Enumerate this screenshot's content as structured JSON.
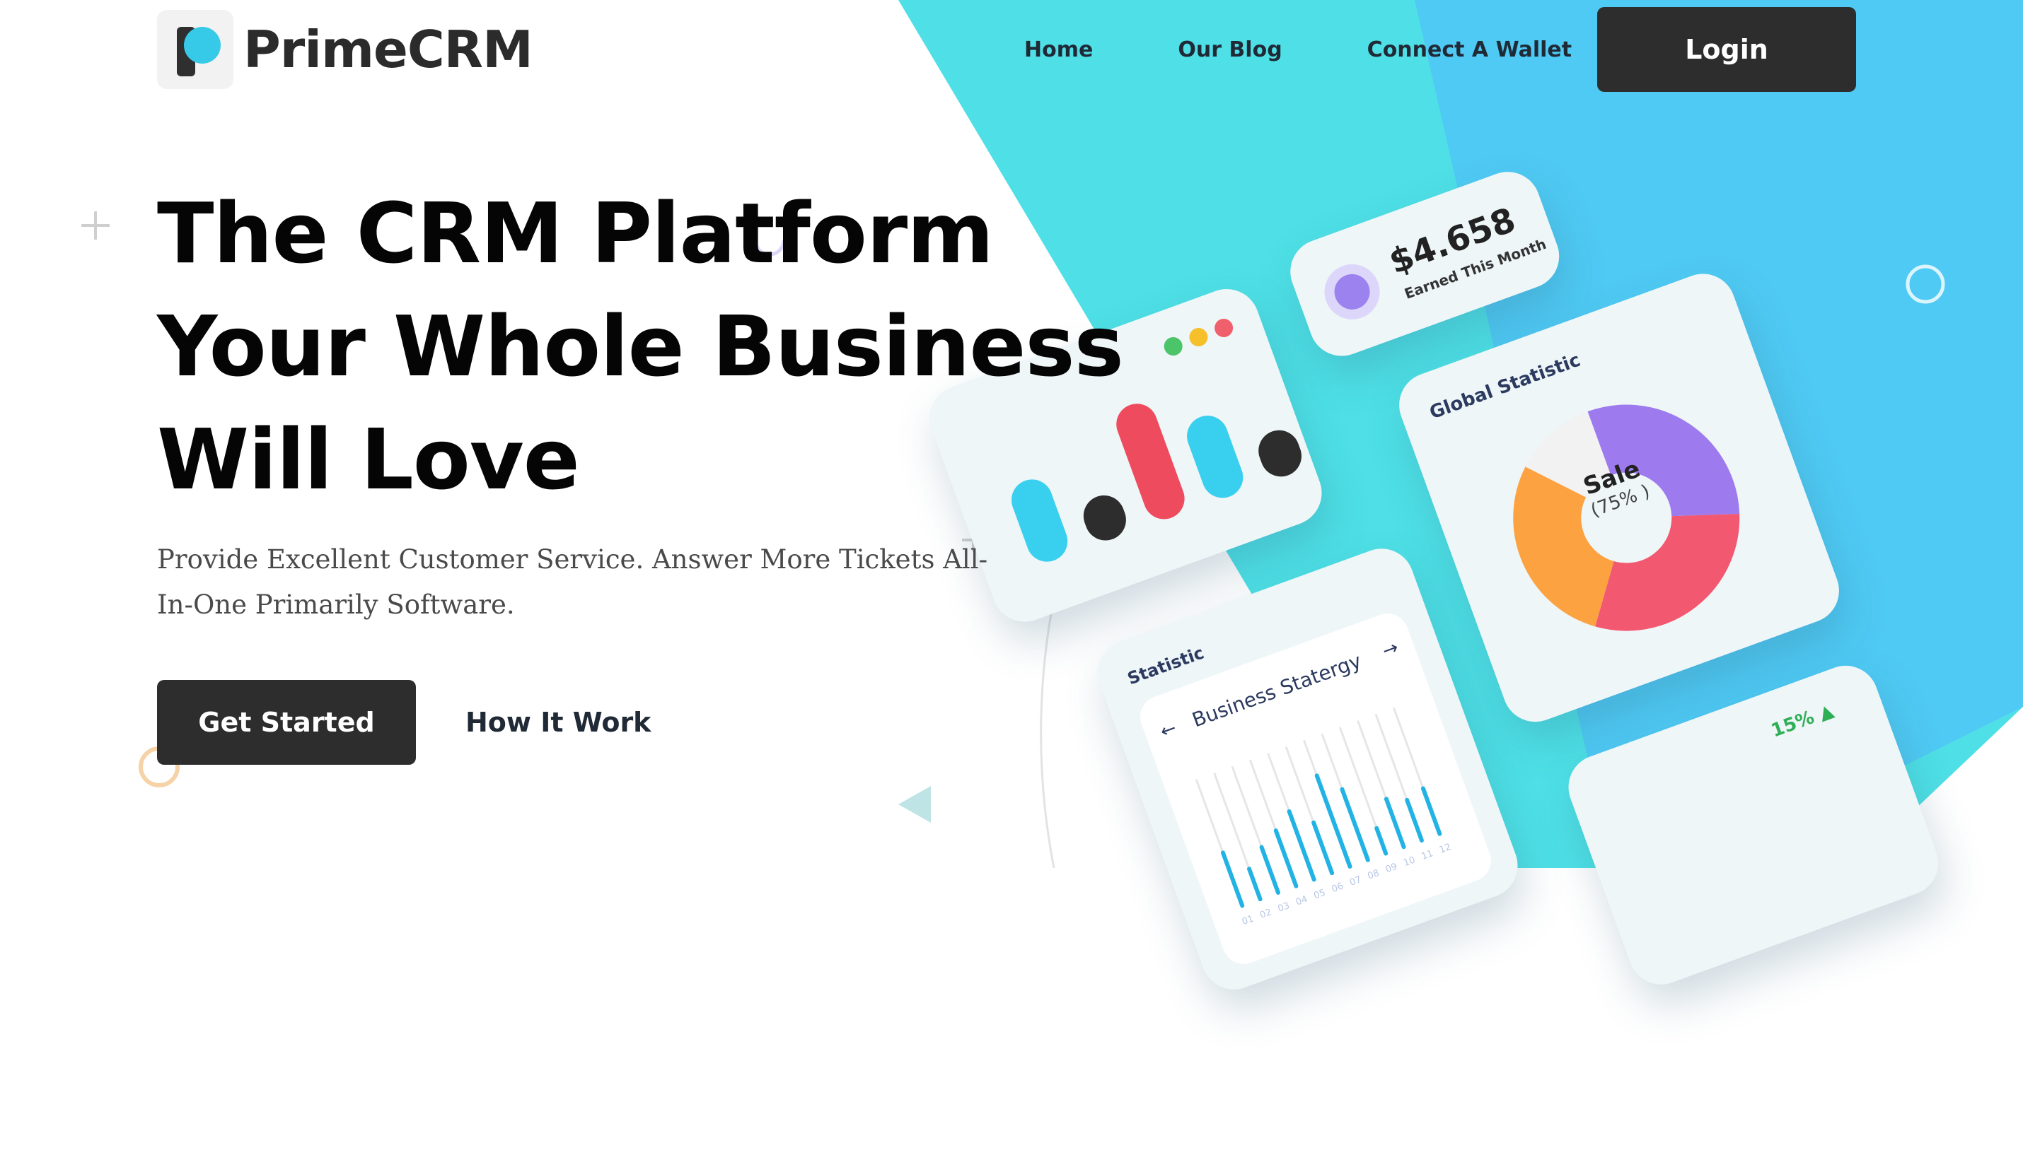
{
  "brand": {
    "name": "PrimeCRM"
  },
  "nav": {
    "links": [
      "Home",
      "Our Blog",
      "Connect A Wallet"
    ],
    "login_label": "Login"
  },
  "hero": {
    "title_lines": [
      "The CRM Platform",
      "Your Whole Business",
      "Will Love"
    ],
    "subtitle": "Provide Excellent Customer Service. Answer More Tickets All-In-One Primarily Software.",
    "primary_cta": "Get Started",
    "secondary_cta": "How It Work"
  },
  "illustration": {
    "earnings": {
      "amount": "$4.658",
      "label": "Earned This Month"
    },
    "statistic": {
      "label": "Statistic",
      "title": "Business Statergy",
      "x_labels": [
        "01",
        "02",
        "03",
        "04",
        "05",
        "06",
        "07",
        "08",
        "09",
        "10",
        "11",
        "12"
      ]
    },
    "global": {
      "label": "Global Statistic",
      "center_title": "Sale",
      "center_value": "(75% )"
    },
    "bottom": {
      "percent": "15%"
    }
  },
  "colors": {
    "accent_cyan": "#36c9e8",
    "dark": "#2d2d2d",
    "bg_teal": "#4ee0e6",
    "bg_blue": "#4fc8f4"
  },
  "chart_data": [
    {
      "type": "bar",
      "title": "Business Statergy",
      "categories": [
        "01",
        "02",
        "03",
        "04",
        "05",
        "06",
        "07",
        "08",
        "09",
        "10",
        "11",
        "12"
      ],
      "values": [
        42,
        24,
        36,
        44,
        54,
        40,
        72,
        56,
        20,
        38,
        32,
        36
      ],
      "ylim": [
        0,
        100
      ]
    },
    {
      "type": "pie",
      "title": "Global Statistic",
      "categories": [
        "Purple",
        "Red",
        "Orange"
      ],
      "values": [
        30,
        30,
        28
      ]
    }
  ]
}
